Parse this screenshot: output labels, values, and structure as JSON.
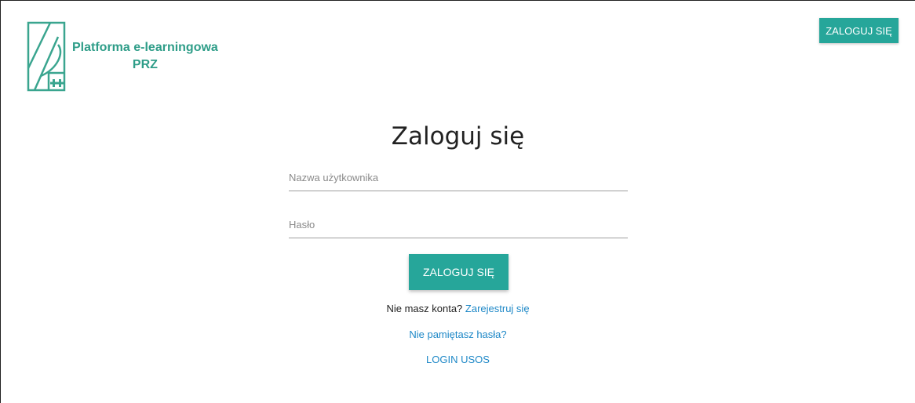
{
  "header": {
    "logo_line1": "Platforma e-learningowa",
    "logo_line2": "PRZ",
    "login_button": "ZALOGUJ SIĘ"
  },
  "form": {
    "title": "Zaloguj się",
    "username_placeholder": "Nazwa użytkownika",
    "password_placeholder": "Hasło",
    "submit_label": "ZALOGUJ SIĘ",
    "no_account_text": "Nie masz konta?",
    "register_link": "Zarejestruj się",
    "forgot_password_link": "Nie pamiętasz hasła?",
    "usos_login_link": "LOGIN USOS"
  },
  "colors": {
    "accent": "#26a69a",
    "brand_text": "#2e9d88",
    "link": "#1e88c7"
  },
  "icons": {
    "logo": "prz-logo-icon"
  }
}
